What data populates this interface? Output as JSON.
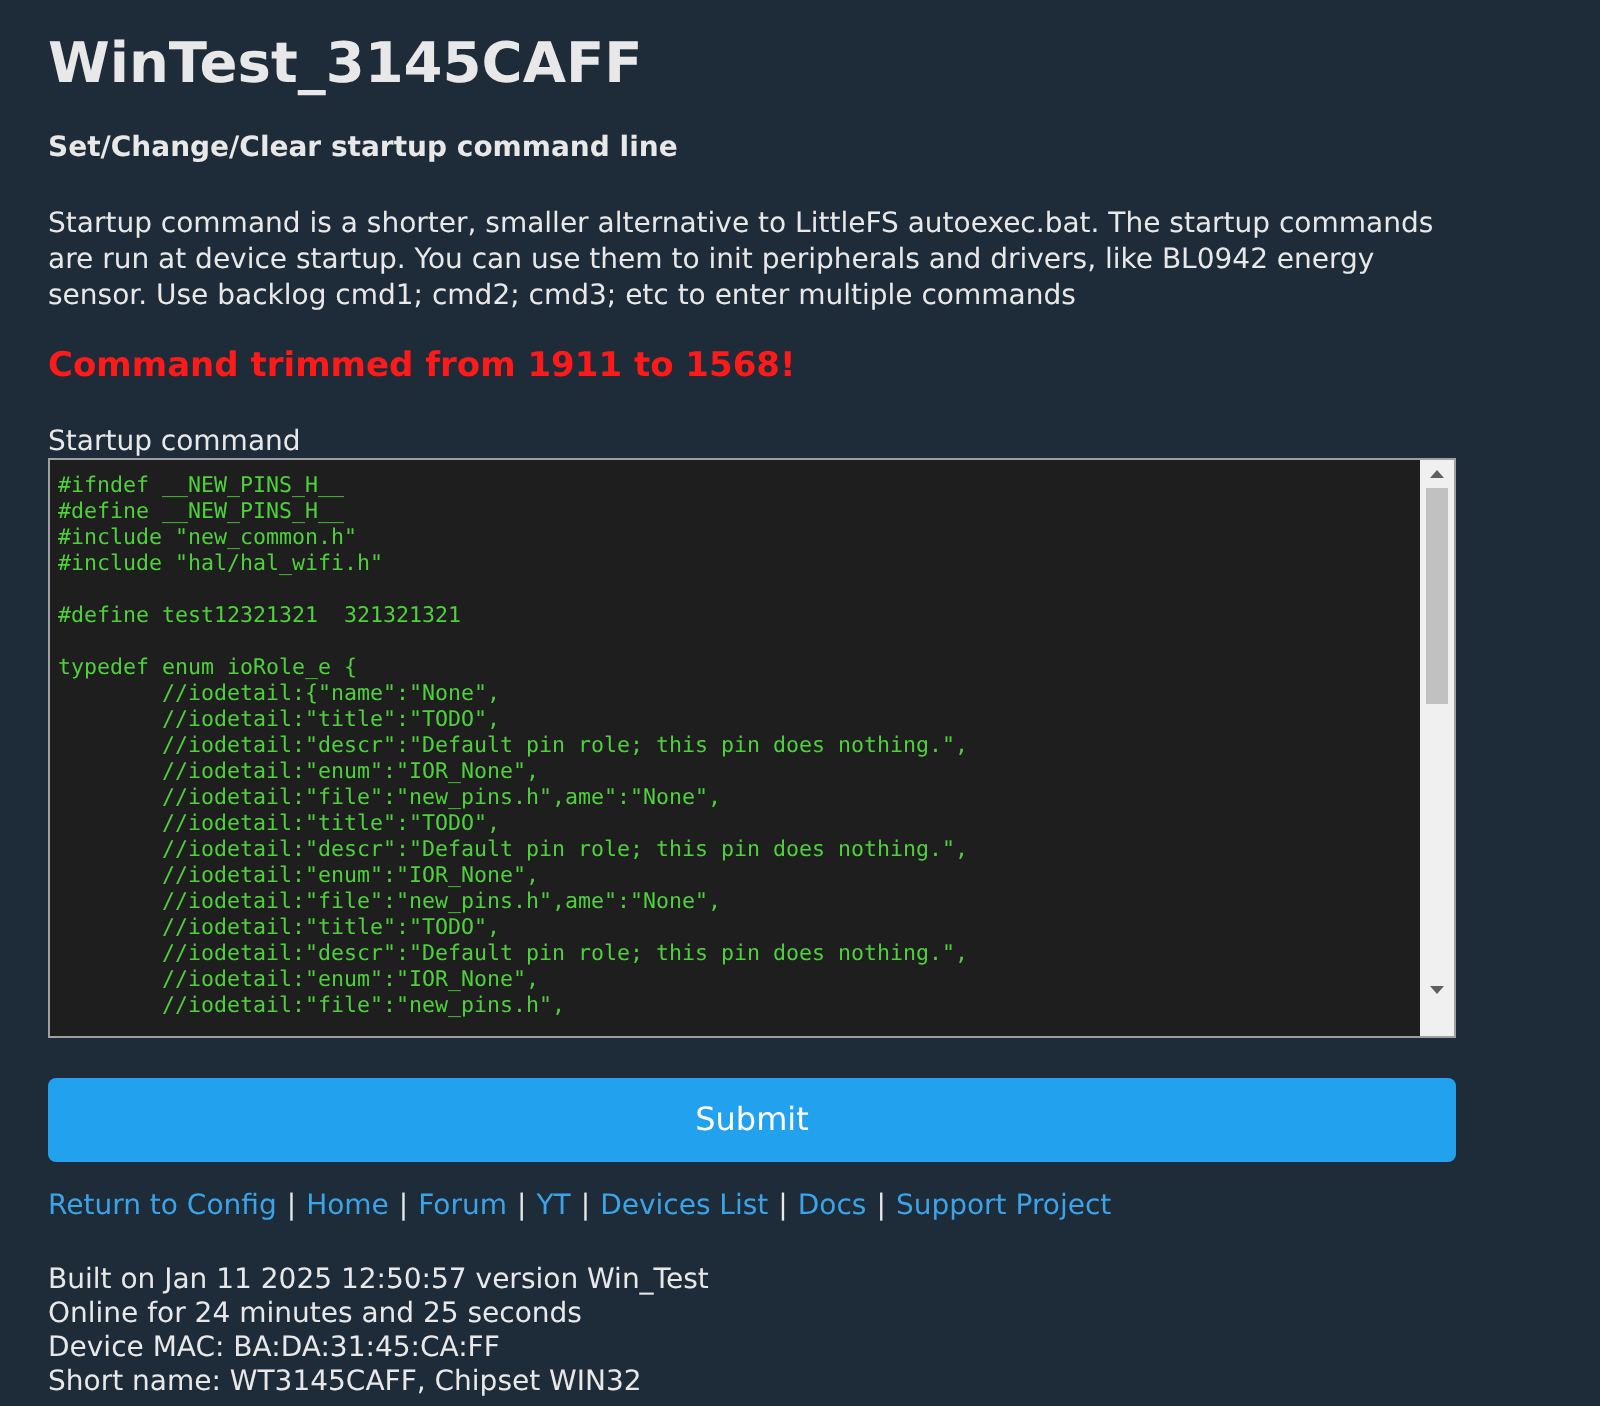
{
  "title": "WinTest_3145CAFF",
  "subtitle": "Set/Change/Clear startup command line",
  "description": "Startup command is a shorter, smaller alternative to LittleFS autoexec.bat. The startup commands are run at device startup. You can use them to init peripherals and drivers, like BL0942 energy sensor. Use backlog cmd1; cmd2; cmd3; etc to enter multiple commands",
  "warning": "Command trimmed from 1911 to 1568!",
  "field": {
    "label": "Startup command",
    "value": "#ifndef __NEW_PINS_H__\n#define __NEW_PINS_H__\n#include \"new_common.h\"\n#include \"hal/hal_wifi.h\"\n\n#define test12321321  321321321\n\ntypedef enum ioRole_e {\n\t//iodetail:{\"name\":\"None\",\n\t//iodetail:\"title\":\"TODO\",\n\t//iodetail:\"descr\":\"Default pin role; this pin does nothing.\",\n\t//iodetail:\"enum\":\"IOR_None\",\n\t//iodetail:\"file\":\"new_pins.h\",ame\":\"None\",\n\t//iodetail:\"title\":\"TODO\",\n\t//iodetail:\"descr\":\"Default pin role; this pin does nothing.\",\n\t//iodetail:\"enum\":\"IOR_None\",\n\t//iodetail:\"file\":\"new_pins.h\",ame\":\"None\",\n\t//iodetail:\"title\":\"TODO\",\n\t//iodetail:\"descr\":\"Default pin role; this pin does nothing.\",\n\t//iodetail:\"enum\":\"IOR_None\",\n\t//iodetail:\"file\":\"new_pins.h\","
  },
  "submit": "Submit",
  "links": [
    "Return to Config",
    "Home",
    "Forum",
    "YT",
    "Devices List",
    "Docs",
    "Support Project"
  ],
  "separator": "|",
  "info": [
    "Built on Jan 11 2025 12:50:57 version Win_Test",
    "Online for 24 minutes and 25 seconds",
    "Device MAC: BA:DA:31:45:CA:FF",
    "Short name: WT3145CAFF, Chipset WIN32"
  ]
}
